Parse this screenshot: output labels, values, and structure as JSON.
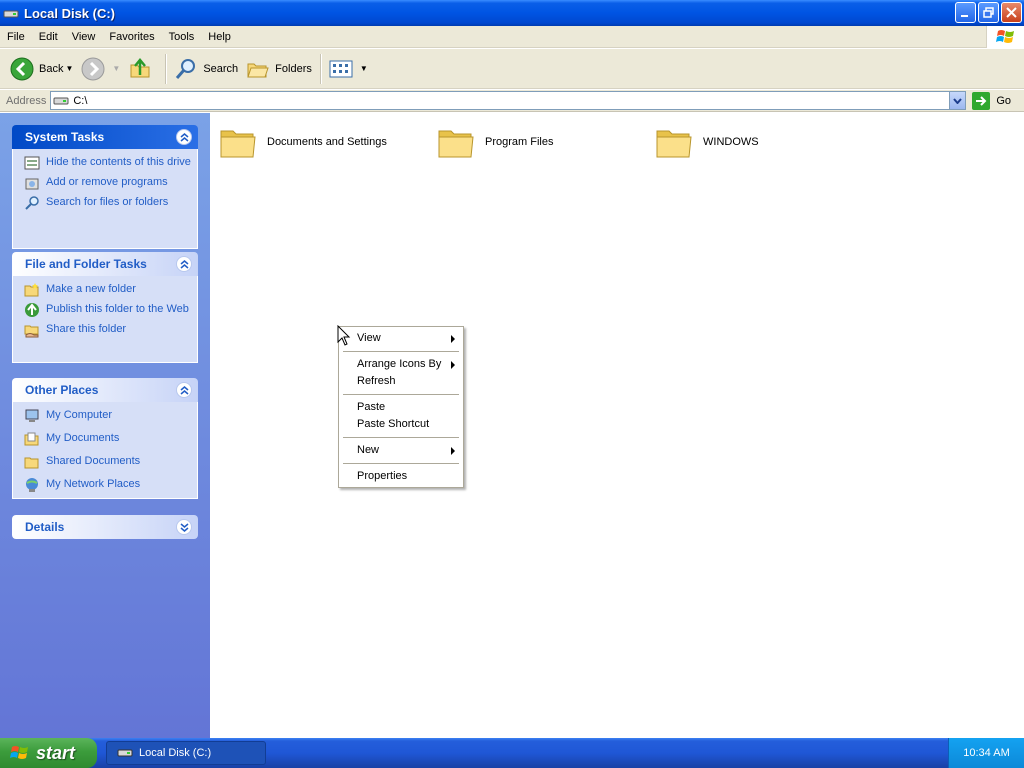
{
  "window": {
    "title": "Local Disk (C:)"
  },
  "menubar": {
    "items": [
      "File",
      "Edit",
      "View",
      "Favorites",
      "Tools",
      "Help"
    ]
  },
  "toolbar": {
    "back_label": "Back",
    "search_label": "Search",
    "folders_label": "Folders"
  },
  "address": {
    "label": "Address",
    "value": "C:\\",
    "go_label": "Go"
  },
  "left_pane": {
    "system_tasks": {
      "title": "System Tasks",
      "items": [
        "Hide the contents of this drive",
        "Add or remove programs",
        "Search for files or folders"
      ]
    },
    "file_folder_tasks": {
      "title": "File and Folder Tasks",
      "items": [
        "Make a new folder",
        "Publish this folder to the Web",
        "Share this folder"
      ]
    },
    "other_places": {
      "title": "Other Places",
      "items": [
        "My Computer",
        "My Documents",
        "Shared Documents",
        "My Network Places"
      ]
    },
    "details": {
      "title": "Details"
    }
  },
  "content": {
    "folders": [
      "Documents and Settings",
      "Program Files",
      "WINDOWS"
    ]
  },
  "context_menu": {
    "items": {
      "view": "View",
      "arrange": "Arrange Icons By",
      "refresh": "Refresh",
      "paste": "Paste",
      "paste_shortcut": "Paste Shortcut",
      "new": "New",
      "properties": "Properties"
    }
  },
  "taskbar": {
    "start_label": "start",
    "task_label": "Local Disk (C:)",
    "clock": "10:34 AM"
  },
  "colors": {
    "titlebar_blue": "#0054e3",
    "left_pane_blue": "#6f8edd",
    "link_blue": "#215dc6",
    "start_green": "#3c9c3c"
  }
}
